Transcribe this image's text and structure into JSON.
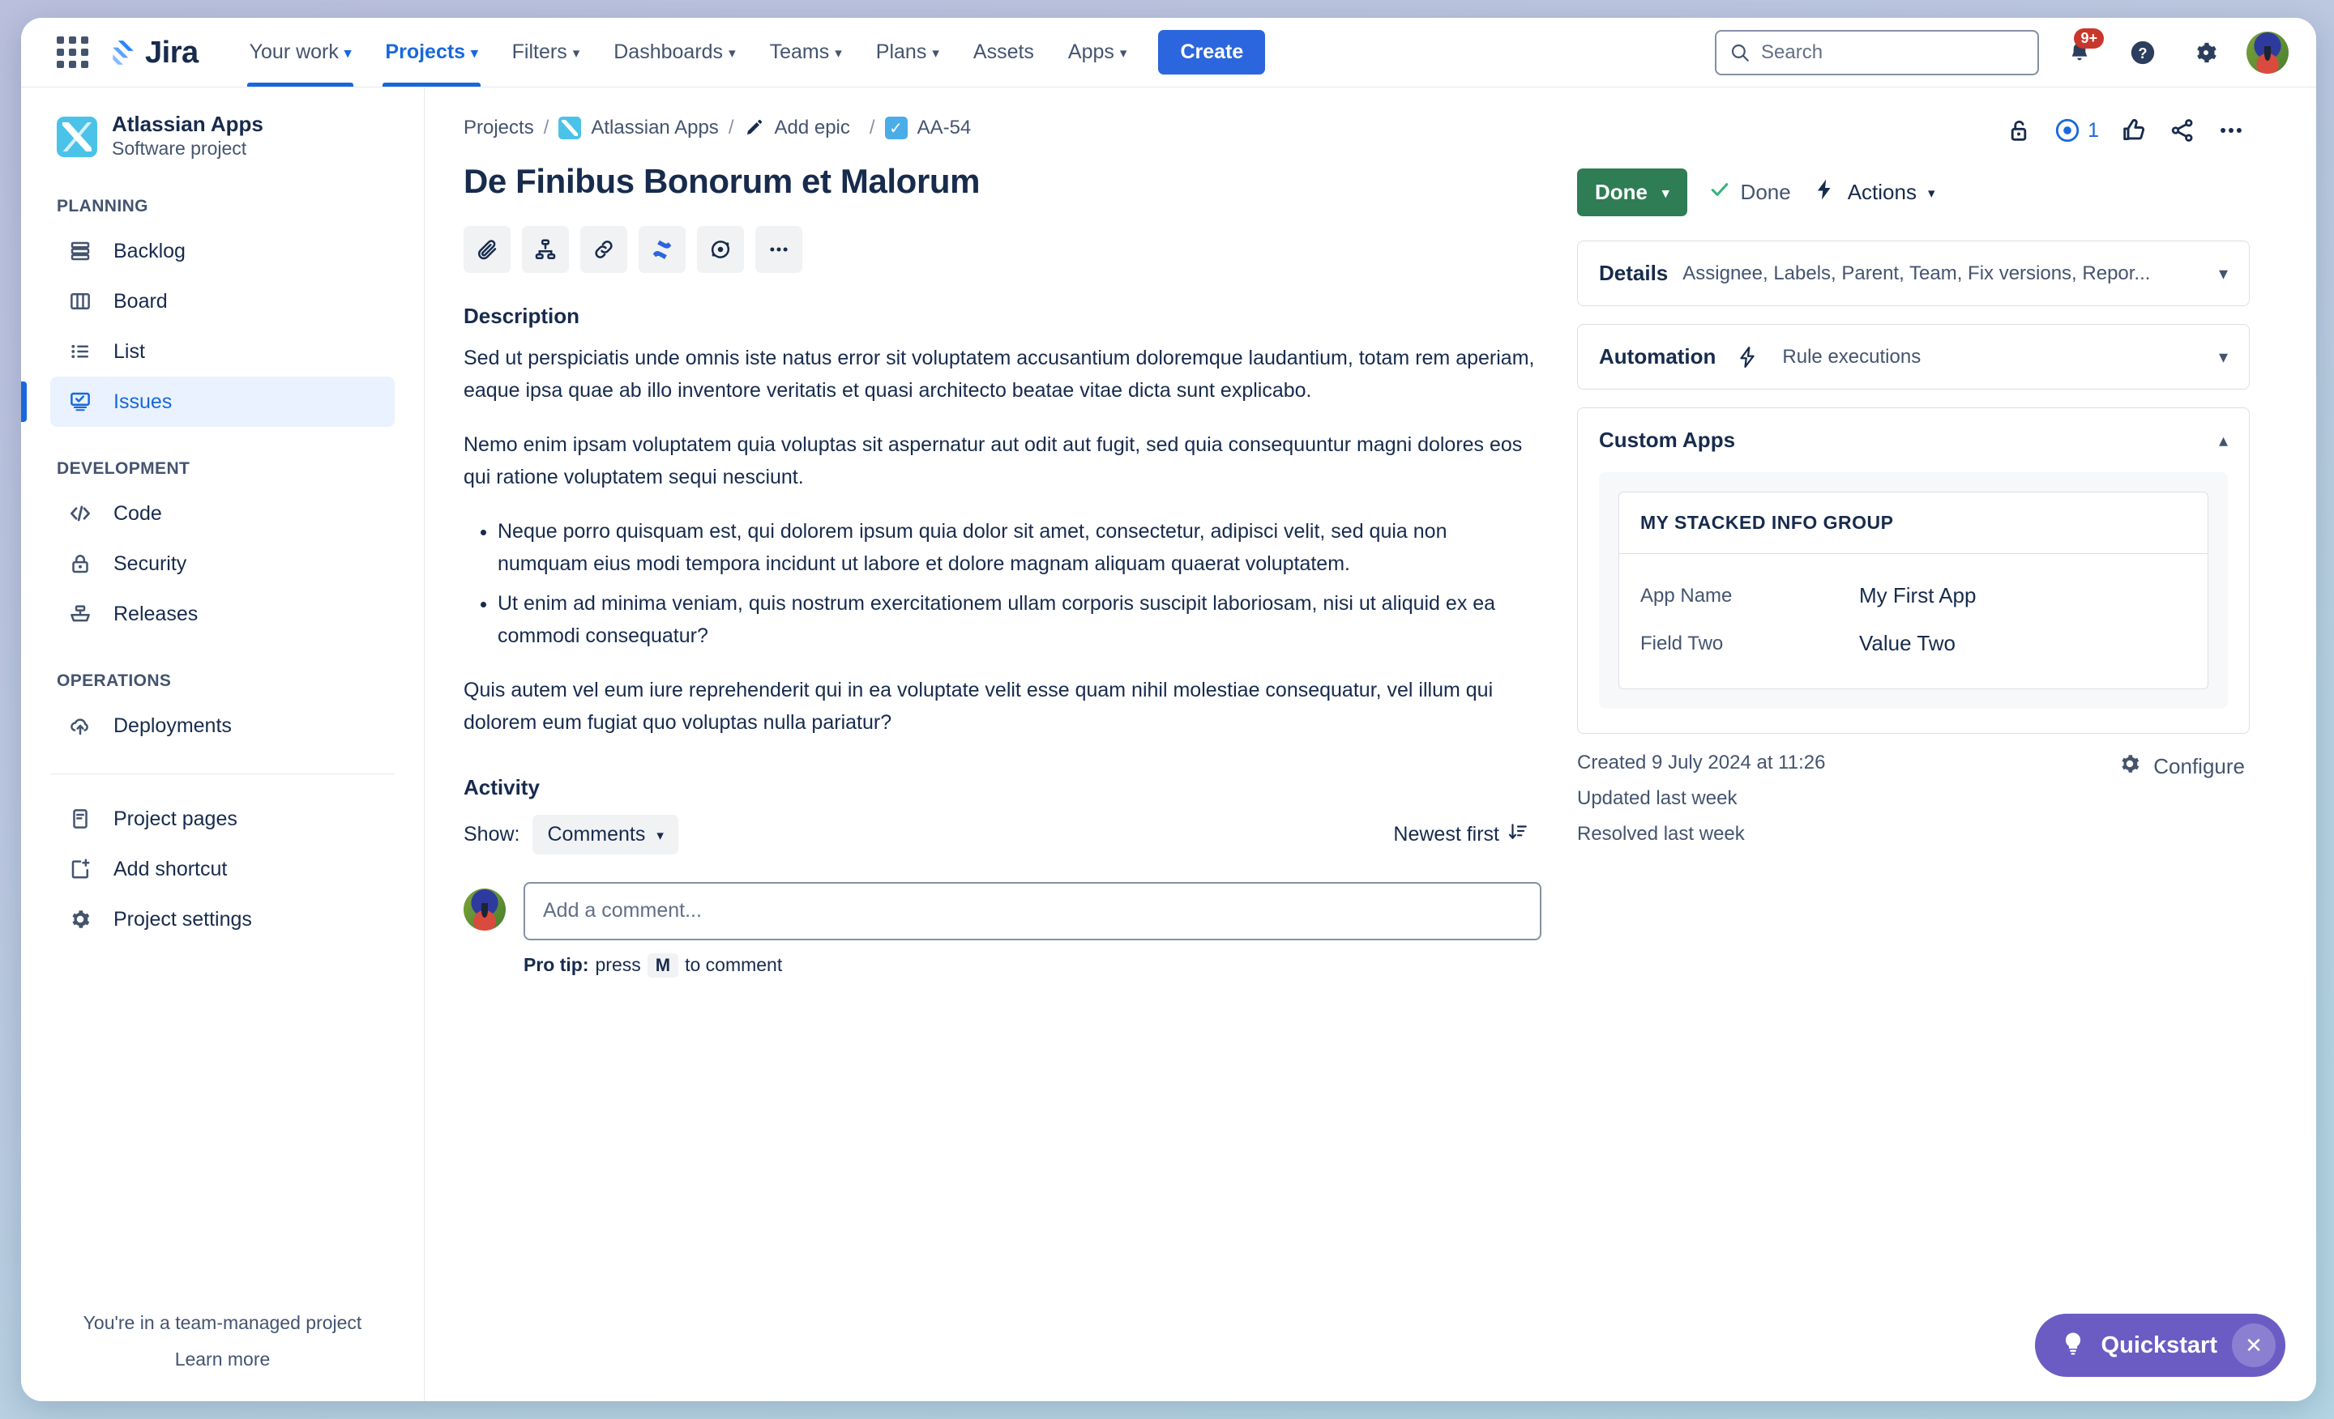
{
  "topnav": {
    "logo_text": "Jira",
    "items": [
      {
        "label": "Your work",
        "has_caret": true,
        "active": false
      },
      {
        "label": "Projects",
        "has_caret": true,
        "active": true
      },
      {
        "label": "Filters",
        "has_caret": true,
        "active": false
      },
      {
        "label": "Dashboards",
        "has_caret": true,
        "active": false
      },
      {
        "label": "Teams",
        "has_caret": true,
        "active": false
      },
      {
        "label": "Plans",
        "has_caret": true,
        "active": false
      },
      {
        "label": "Assets",
        "has_caret": false,
        "active": false
      },
      {
        "label": "Apps",
        "has_caret": true,
        "active": false
      }
    ],
    "create_label": "Create",
    "search_placeholder": "Search",
    "notification_badge": "9+"
  },
  "sidebar": {
    "project_name": "Atlassian Apps",
    "project_type": "Software project",
    "groups": [
      {
        "label": "PLANNING",
        "items": [
          {
            "label": "Backlog",
            "icon": "backlog-icon",
            "selected": false
          },
          {
            "label": "Board",
            "icon": "board-icon",
            "selected": false
          },
          {
            "label": "List",
            "icon": "list-icon",
            "selected": false
          },
          {
            "label": "Issues",
            "icon": "issues-icon",
            "selected": true
          }
        ]
      },
      {
        "label": "DEVELOPMENT",
        "items": [
          {
            "label": "Code",
            "icon": "code-icon",
            "selected": false
          },
          {
            "label": "Security",
            "icon": "lock-icon",
            "selected": false
          },
          {
            "label": "Releases",
            "icon": "releases-icon",
            "selected": false
          }
        ]
      },
      {
        "label": "OPERATIONS",
        "items": [
          {
            "label": "Deployments",
            "icon": "deployments-icon",
            "selected": false
          }
        ]
      }
    ],
    "extra_items": [
      {
        "label": "Project pages",
        "icon": "page-icon"
      },
      {
        "label": "Add shortcut",
        "icon": "add-shortcut-icon"
      },
      {
        "label": "Project settings",
        "icon": "gear-icon"
      }
    ],
    "footer_note": "You're in a team-managed project",
    "footer_link": "Learn more"
  },
  "breadcrumb": {
    "projects": "Projects",
    "project": "Atlassian Apps",
    "epic": "Add epic",
    "issue_key": "AA-54",
    "separator": "/"
  },
  "issue": {
    "title": "De Finibus Bonorum et Malorum",
    "toolbar_icons": [
      "attach-icon",
      "child-issue-icon",
      "link-icon",
      "confluence-icon",
      "loom-icon",
      "more-icon"
    ]
  },
  "description": {
    "heading": "Description",
    "paragraph1": "Sed ut perspiciatis unde omnis iste natus error sit voluptatem accusantium doloremque laudantium, totam rem aperiam, eaque ipsa quae ab illo inventore veritatis et quasi architecto beatae vitae dicta sunt explicabo.",
    "paragraph2": "Nemo enim ipsam voluptatem quia voluptas sit aspernatur aut odit aut fugit, sed quia consequuntur magni dolores eos qui ratione voluptatem sequi nesciunt.",
    "bullets": [
      "Neque porro quisquam est, qui dolorem ipsum quia dolor sit amet, consectetur, adipisci velit, sed quia non numquam eius modi tempora incidunt ut labore et dolore magnam aliquam quaerat voluptatem.",
      "Ut enim ad minima veniam, quis nostrum exercitationem ullam corporis suscipit laboriosam, nisi ut aliquid ex ea commodi consequatur?"
    ],
    "paragraph3": "Quis autem vel eum iure reprehenderit qui in ea voluptate velit esse quam nihil molestiae consequatur, vel illum qui dolorem eum fugiat quo voluptas nulla pariatur?"
  },
  "activity": {
    "heading": "Activity",
    "show_label": "Show:",
    "show_value": "Comments",
    "sort_label": "Newest first",
    "comment_placeholder": "Add a comment...",
    "protip_prefix": "Pro tip:",
    "protip_press": "press",
    "protip_key": "M",
    "protip_suffix": "to comment"
  },
  "right_panel": {
    "watch_count": "1",
    "status_button": "Done",
    "status_text": "Done",
    "actions_label": "Actions",
    "panels": [
      {
        "title": "Details",
        "subtitle": "Assignee, Labels, Parent, Team, Fix versions, Repor...",
        "expanded": false
      },
      {
        "title": "Automation",
        "subtitle": "Rule executions",
        "expanded": false
      },
      {
        "title": "Custom Apps",
        "subtitle": "",
        "expanded": true
      }
    ],
    "custom_app": {
      "group_title": "MY STACKED INFO GROUP",
      "rows": [
        {
          "label": "App Name",
          "value": "My First App"
        },
        {
          "label": "Field Two",
          "value": "Value Two"
        }
      ]
    },
    "meta": {
      "created": "Created 9 July 2024 at 11:26",
      "updated": "Updated last week",
      "resolved": "Resolved last week",
      "configure": "Configure"
    }
  },
  "quickstart": {
    "label": "Quickstart"
  },
  "colors": {
    "accent_blue": "#1868DB",
    "create_blue": "#2B66DE",
    "done_green": "#2E7D54",
    "badge_red": "#C9372C",
    "quickstart_purple": "#6B5CC4",
    "project_icon": "#4BC3E8"
  }
}
